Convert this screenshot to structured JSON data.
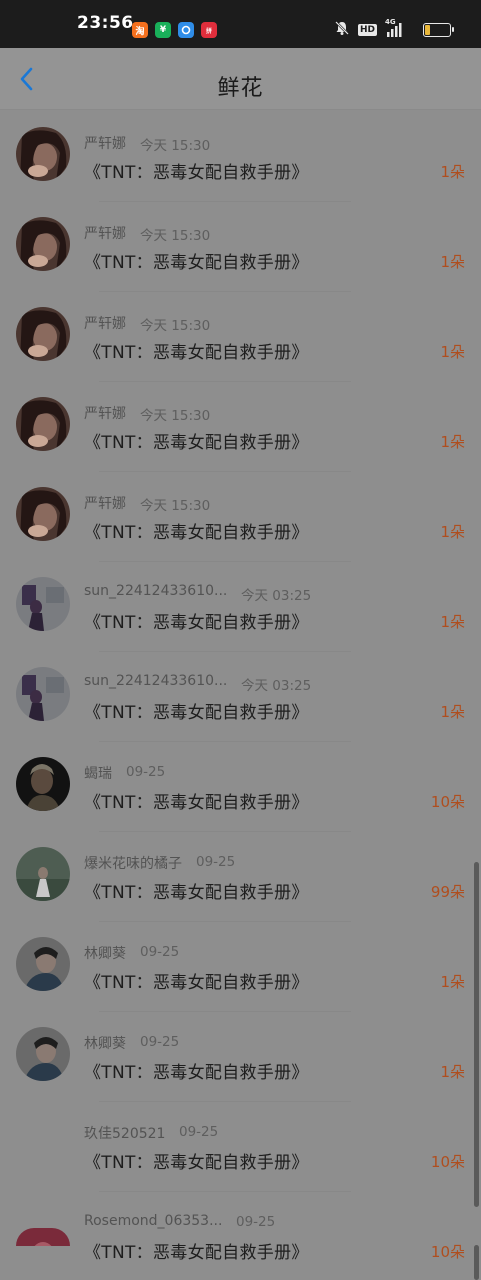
{
  "status_bar": {
    "time": "23:56",
    "network": "4G",
    "hd": "HD",
    "battery_level": 0.22,
    "battery_color": "#e8b73a",
    "app_icons": [
      "taobao-icon",
      "wechat-pay-icon",
      "browser-icon",
      "pinduoduo-icon"
    ]
  },
  "header": {
    "title": "鲜花",
    "back_icon": "chevron-left-icon",
    "accent": "#1a78d6"
  },
  "colors": {
    "count": "#b04e1e",
    "overlay": "#8e8e8e"
  },
  "items": [
    {
      "username": "严轩娜",
      "time": "今天 15:30",
      "book": "《TNT：恶毒女配自救手册》",
      "count": "1朵",
      "avatar": "avatar-1"
    },
    {
      "username": "严轩娜",
      "time": "今天 15:30",
      "book": "《TNT：恶毒女配自救手册》",
      "count": "1朵",
      "avatar": "avatar-1"
    },
    {
      "username": "严轩娜",
      "time": "今天 15:30",
      "book": "《TNT：恶毒女配自救手册》",
      "count": "1朵",
      "avatar": "avatar-1"
    },
    {
      "username": "严轩娜",
      "time": "今天 15:30",
      "book": "《TNT：恶毒女配自救手册》",
      "count": "1朵",
      "avatar": "avatar-1"
    },
    {
      "username": "严轩娜",
      "time": "今天 15:30",
      "book": "《TNT：恶毒女配自救手册》",
      "count": "1朵",
      "avatar": "avatar-1"
    },
    {
      "username": "sun_22412433610...",
      "time": "今天 03:25",
      "book": "《TNT：恶毒女配自救手册》",
      "count": "1朵",
      "avatar": "avatar-2"
    },
    {
      "username": "sun_22412433610...",
      "time": "今天 03:25",
      "book": "《TNT：恶毒女配自救手册》",
      "count": "1朵",
      "avatar": "avatar-2"
    },
    {
      "username": "蝎瑞",
      "time": "09-25",
      "book": "《TNT：恶毒女配自救手册》",
      "count": "10朵",
      "avatar": "avatar-3"
    },
    {
      "username": "爆米花味的橘子",
      "time": "09-25",
      "book": "《TNT：恶毒女配自救手册》",
      "count": "99朵",
      "avatar": "avatar-4"
    },
    {
      "username": "林卿葵",
      "time": "09-25",
      "book": "《TNT：恶毒女配自救手册》",
      "count": "1朵",
      "avatar": "avatar-5"
    },
    {
      "username": "林卿葵",
      "time": "09-25",
      "book": "《TNT：恶毒女配自救手册》",
      "count": "1朵",
      "avatar": "avatar-5"
    },
    {
      "username": "玖佳520521",
      "time": "09-25",
      "book": "《TNT：恶毒女配自救手册》",
      "count": "10朵",
      "avatar": "none"
    },
    {
      "username": "Rosemond_06353...",
      "time": "09-25",
      "book": "《TNT：恶毒女配自救手册》",
      "count": "10朵",
      "avatar": "avatar-6"
    }
  ]
}
